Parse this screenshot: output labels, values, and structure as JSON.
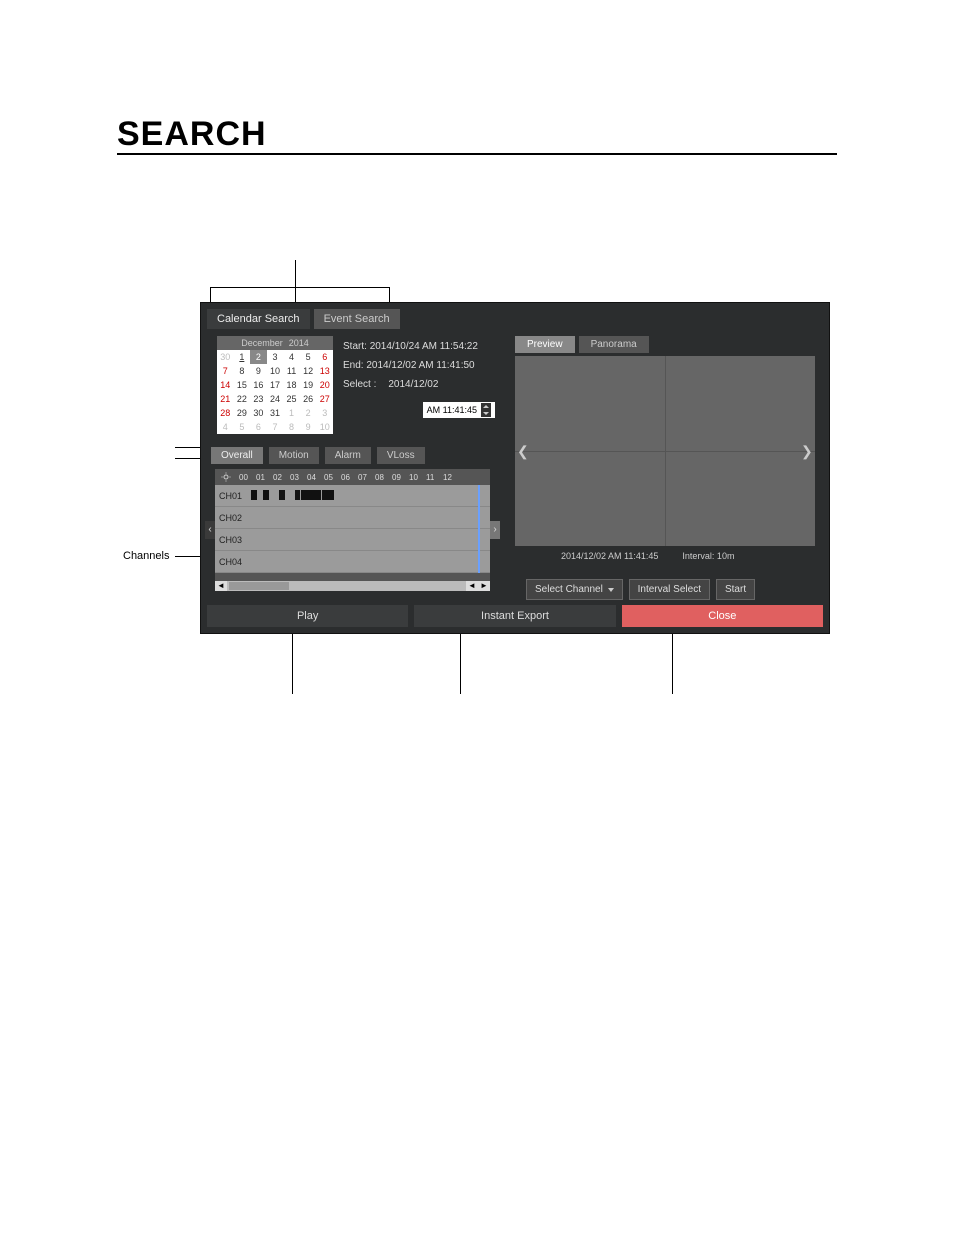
{
  "page_title": "SEARCH",
  "callouts": {
    "channels": "Channels"
  },
  "search_tabs": {
    "calendar": "Calendar Search",
    "event": "Event Search"
  },
  "calendar": {
    "month": "December",
    "year": "2014",
    "rows": [
      [
        {
          "v": "30",
          "cls": "dim"
        },
        {
          "v": "1",
          "cls": "underline"
        },
        {
          "v": "2",
          "cls": "sel"
        },
        {
          "v": "3",
          "cls": ""
        },
        {
          "v": "4",
          "cls": ""
        },
        {
          "v": "5",
          "cls": ""
        },
        {
          "v": "6",
          "cls": "red"
        }
      ],
      [
        {
          "v": "7",
          "cls": "red"
        },
        {
          "v": "8",
          "cls": ""
        },
        {
          "v": "9",
          "cls": ""
        },
        {
          "v": "10",
          "cls": ""
        },
        {
          "v": "11",
          "cls": ""
        },
        {
          "v": "12",
          "cls": ""
        },
        {
          "v": "13",
          "cls": "red"
        }
      ],
      [
        {
          "v": "14",
          "cls": "red"
        },
        {
          "v": "15",
          "cls": ""
        },
        {
          "v": "16",
          "cls": ""
        },
        {
          "v": "17",
          "cls": ""
        },
        {
          "v": "18",
          "cls": ""
        },
        {
          "v": "19",
          "cls": ""
        },
        {
          "v": "20",
          "cls": "red"
        }
      ],
      [
        {
          "v": "21",
          "cls": "red"
        },
        {
          "v": "22",
          "cls": ""
        },
        {
          "v": "23",
          "cls": ""
        },
        {
          "v": "24",
          "cls": ""
        },
        {
          "v": "25",
          "cls": ""
        },
        {
          "v": "26",
          "cls": ""
        },
        {
          "v": "27",
          "cls": "red"
        }
      ],
      [
        {
          "v": "28",
          "cls": "red"
        },
        {
          "v": "29",
          "cls": ""
        },
        {
          "v": "30",
          "cls": ""
        },
        {
          "v": "31",
          "cls": ""
        },
        {
          "v": "1",
          "cls": "dim"
        },
        {
          "v": "2",
          "cls": "dim"
        },
        {
          "v": "3",
          "cls": "dim"
        }
      ],
      [
        {
          "v": "4",
          "cls": "dim"
        },
        {
          "v": "5",
          "cls": "dim"
        },
        {
          "v": "6",
          "cls": "dim"
        },
        {
          "v": "7",
          "cls": "dim"
        },
        {
          "v": "8",
          "cls": "dim"
        },
        {
          "v": "9",
          "cls": "dim"
        },
        {
          "v": "10",
          "cls": "dim"
        }
      ]
    ]
  },
  "timeinfo": {
    "start_label": "Start:",
    "start_value": "2014/10/24 AM 11:54:22",
    "end_label": "End:",
    "end_value": "2014/12/02 AM 11:41:50",
    "select_label": "Select :",
    "select_date": "2014/12/02",
    "select_time": "AM 11:41:45"
  },
  "event_tabs": {
    "overall": "Overall",
    "motion": "Motion",
    "alarm": "Alarm",
    "vloss": "VLoss"
  },
  "timeline": {
    "hours": [
      "00",
      "01",
      "02",
      "03",
      "04",
      "05",
      "06",
      "07",
      "08",
      "09",
      "10",
      "11",
      "12"
    ],
    "channels": [
      "CH01",
      "CH02",
      "CH03",
      "CH04"
    ]
  },
  "preview": {
    "tab_preview": "Preview",
    "tab_panorama": "Panorama",
    "timestamp": "2014/12/02 AM 11:41:45",
    "interval": "Interval: 10m",
    "select_channel": "Select Channel",
    "interval_select": "Interval Select",
    "start": "Start"
  },
  "bottom": {
    "play": "Play",
    "export": "Instant Export",
    "close": "Close"
  }
}
